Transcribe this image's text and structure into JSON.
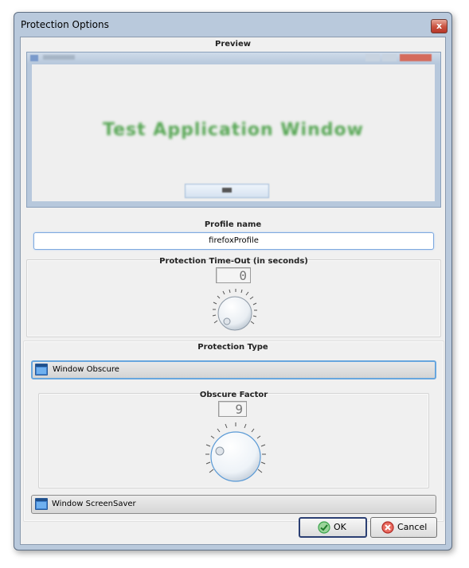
{
  "window": {
    "title": "Protection Options",
    "close_glyph": "x"
  },
  "preview": {
    "label": "Preview",
    "window_heading": "Test Application Window"
  },
  "profile": {
    "label": "Profile name",
    "value": "firefoxProfile"
  },
  "timeout": {
    "label": "Protection Time-Out (in seconds)",
    "display": "0",
    "knob_value": 0
  },
  "protection_type": {
    "label": "Protection Type",
    "options": [
      {
        "label": "Window Obscure",
        "icon": "window-icon",
        "active": true
      },
      {
        "label": "Window ScreenSaver",
        "icon": "window-icon",
        "active": false
      }
    ]
  },
  "obscure_factor": {
    "label": "Obscure Factor",
    "display": "9",
    "knob_value": 9
  },
  "buttons": {
    "ok_label": "OK",
    "cancel_label": "Cancel"
  },
  "colors": {
    "accent": "#67a6de",
    "ok_icon": "#3aa34a",
    "cancel_icon": "#d23b34",
    "preview_text": "#3d9a3a"
  }
}
